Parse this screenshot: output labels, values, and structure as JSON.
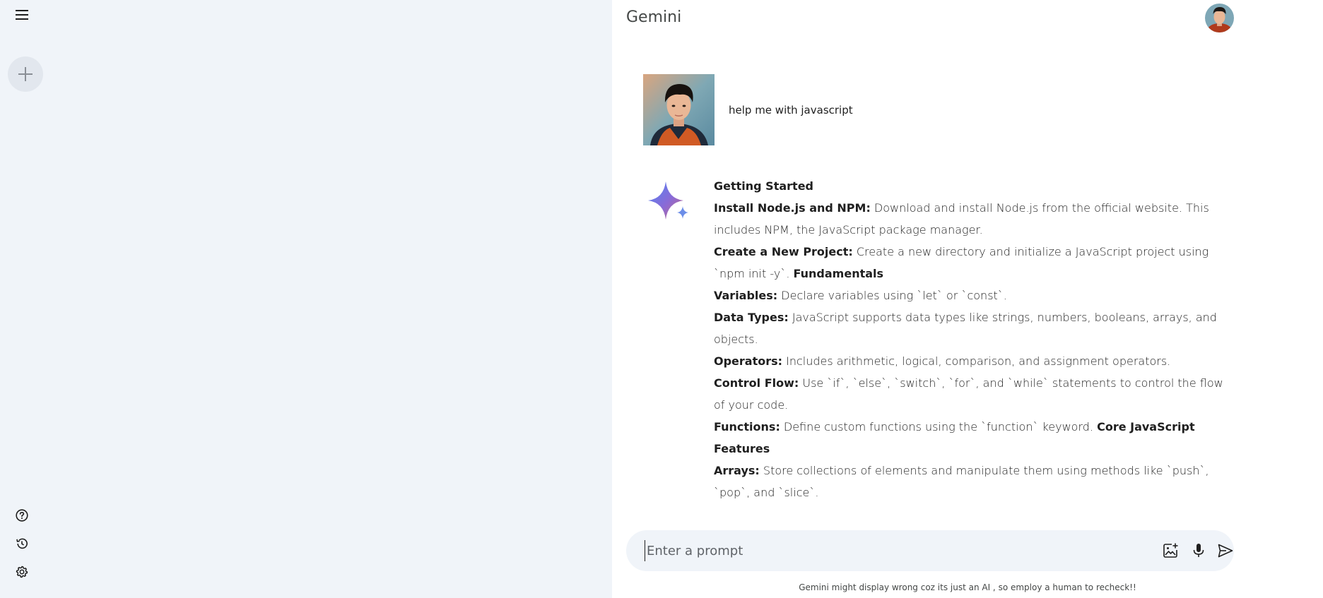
{
  "app": {
    "title": "Gemini"
  },
  "sidebar": {
    "menu_icon": "hamburger-menu-icon",
    "new_chat_icon": "plus-icon",
    "bottom_icons": [
      "help-icon",
      "history-icon",
      "settings-icon"
    ]
  },
  "conversation": {
    "user_message": "help me with javascript",
    "response": {
      "lines": [
        {
          "bold": "Getting Started",
          "text": ""
        },
        {
          "bold": "Install Node.js and NPM:",
          "text": " Download and install Node.js from the official website. This includes NPM, the JavaScript package manager."
        },
        {
          "bold": "Create a New Project:",
          "text": " Create a new directory and initialize a JavaScript project using `npm init -y`. ",
          "bold2": "Fundamentals"
        },
        {
          "bold": "Variables:",
          "text": " Declare variables using `let` or `const`."
        },
        {
          "bold": "Data Types:",
          "text": " JavaScript supports data types like strings, numbers, booleans, arrays, and objects."
        },
        {
          "bold": "Operators:",
          "text": " Includes arithmetic, logical, comparison, and assignment operators."
        },
        {
          "bold": "Control Flow:",
          "text": " Use `if`, `else`, `switch`, `for`, and `while` statements to control the flow of your code."
        },
        {
          "bold": "Functions:",
          "text": " Define custom functions using the `function` keyword. ",
          "bold2": "Core JavaScript Features"
        },
        {
          "bold": "Arrays:",
          "text": " Store collections of elements and manipulate them using methods like `push`, `pop`, and `slice`."
        }
      ]
    }
  },
  "prompt": {
    "placeholder": "Enter a prompt",
    "value": "",
    "icons": [
      "add-image-icon",
      "microphone-icon",
      "send-icon"
    ]
  },
  "footer": {
    "disclaimer": "Gemini might display wrong coz its just an AI , so employ a human to recheck!!"
  },
  "colors": {
    "sidebar_bg": "#f0f4f9",
    "prompt_bg": "#f0f4f9",
    "text": "#1f1f1f"
  }
}
